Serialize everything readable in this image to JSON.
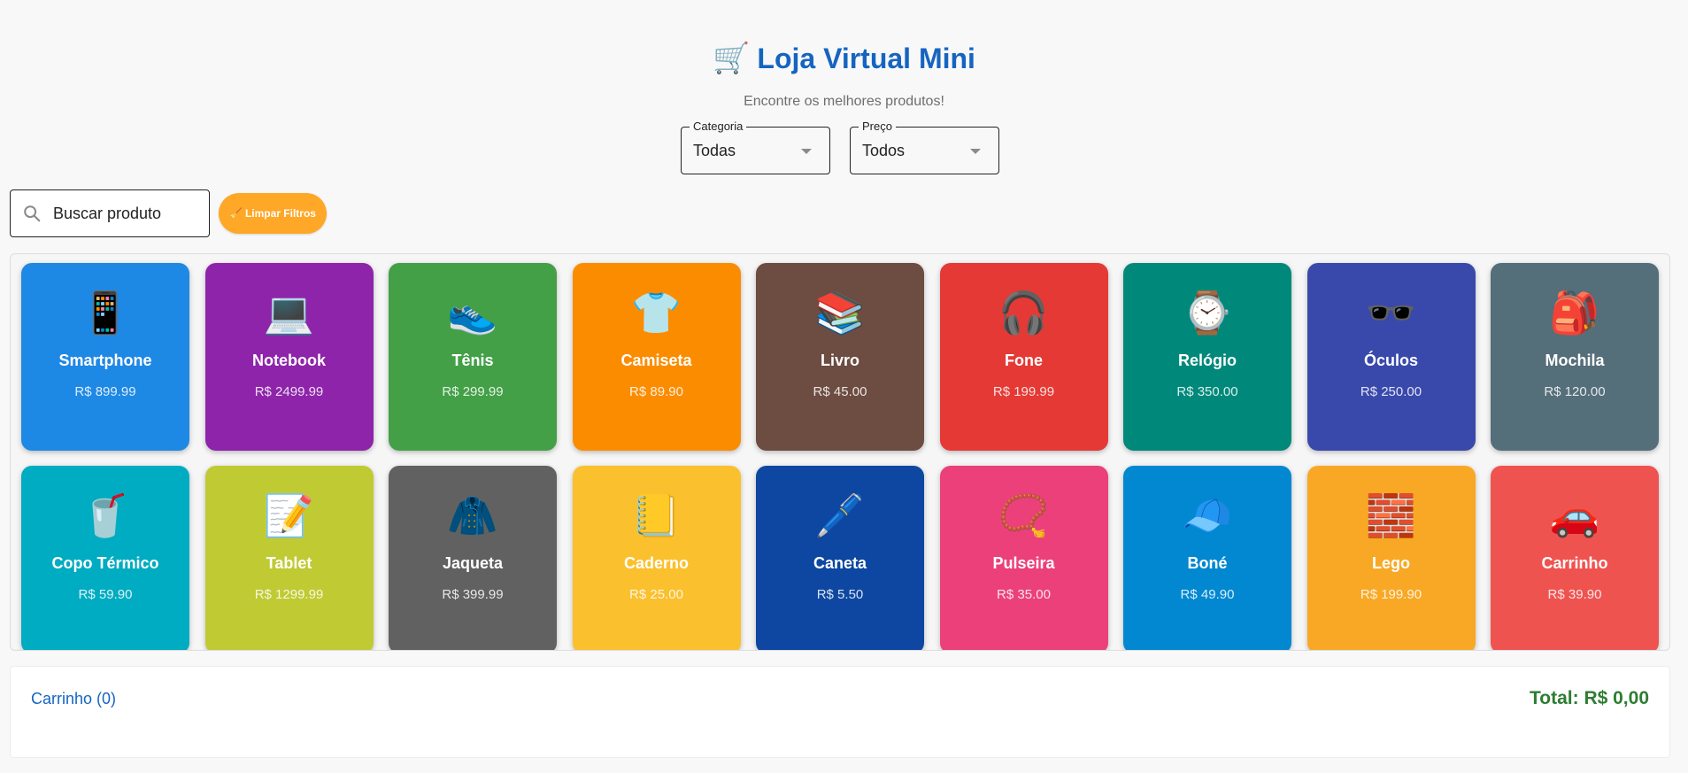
{
  "header": {
    "cart_emoji": "🛒",
    "title": "Loja Virtual Mini",
    "subtitle": "Encontre os melhores produtos!"
  },
  "filters": {
    "category": {
      "label": "Categoria",
      "value": "Todas"
    },
    "price": {
      "label": "Preço",
      "value": "Todos"
    },
    "search": {
      "placeholder": "Buscar produto",
      "value": ""
    },
    "clear_button": {
      "icon": "🧹",
      "label": "Limpar Filtros",
      "color": "#ffa726"
    }
  },
  "products": [
    {
      "name": "Smartphone",
      "price": "R$ 899.99",
      "emoji": "📱",
      "color": "#1e88e5"
    },
    {
      "name": "Notebook",
      "price": "R$ 2499.99",
      "emoji": "💻",
      "color": "#8e24aa"
    },
    {
      "name": "Tênis",
      "price": "R$ 299.99",
      "emoji": "👟",
      "color": "#43a047"
    },
    {
      "name": "Camiseta",
      "price": "R$ 89.90",
      "emoji": "👕",
      "color": "#fb8c00"
    },
    {
      "name": "Livro",
      "price": "R$ 45.00",
      "emoji": "📚",
      "color": "#6d4c41"
    },
    {
      "name": "Fone",
      "price": "R$ 199.99",
      "emoji": "🎧",
      "color": "#e53935"
    },
    {
      "name": "Relógio",
      "price": "R$ 350.00",
      "emoji": "⌚",
      "color": "#00897b"
    },
    {
      "name": "Óculos",
      "price": "R$ 250.00",
      "emoji": "🕶️",
      "color": "#3949ab"
    },
    {
      "name": "Mochila",
      "price": "R$ 120.00",
      "emoji": "🎒",
      "color": "#546e7a"
    },
    {
      "name": "Copo Térmico",
      "price": "R$ 59.90",
      "emoji": "🥤",
      "color": "#00acc1"
    },
    {
      "name": "Tablet",
      "price": "R$ 1299.99",
      "emoji": "📝",
      "color": "#c0ca33"
    },
    {
      "name": "Jaqueta",
      "price": "R$ 399.99",
      "emoji": "🧥",
      "color": "#616161"
    },
    {
      "name": "Caderno",
      "price": "R$ 25.00",
      "emoji": "📒",
      "color": "#fbc02d"
    },
    {
      "name": "Caneta",
      "price": "R$ 5.50",
      "emoji": "🖊️",
      "color": "#0d47a1"
    },
    {
      "name": "Pulseira",
      "price": "R$ 35.00",
      "emoji": "📿",
      "color": "#ec407a"
    },
    {
      "name": "Boné",
      "price": "R$ 49.90",
      "emoji": "🧢",
      "color": "#0288d1"
    },
    {
      "name": "Lego",
      "price": "R$ 199.90",
      "emoji": "🧱",
      "color": "#f9a825"
    },
    {
      "name": "Carrinho",
      "price": "R$ 39.90",
      "emoji": "🚗",
      "color": "#ef5350"
    }
  ],
  "cart": {
    "label": "Carrinho (0)",
    "total": "Total: R$ 0,00"
  }
}
